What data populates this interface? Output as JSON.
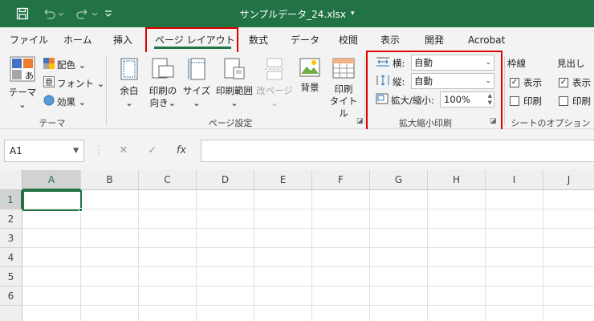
{
  "titlebar": {
    "save_icon": "save-icon",
    "undo_icon": "undo-icon",
    "redo_icon": "redo-icon",
    "customize_icon": "customize-qa-icon",
    "filename": "サンプルデータ_24.xlsx",
    "caret": "▾"
  },
  "tabs": [
    "ファイル",
    "ホーム",
    "挿入",
    "ページ レイアウト",
    "数式",
    "データ",
    "校閲",
    "表示",
    "開発",
    "Acrobat"
  ],
  "ribbon": {
    "theme": {
      "theme_label": "テーマ",
      "theme_caret": "⌄",
      "colors": "配色 ⌄",
      "fonts": "フォント ⌄",
      "effects": "効果 ⌄",
      "group": "テーマ"
    },
    "page_setup": {
      "margins": "余白",
      "orientation": "印刷の",
      "orientation2": "向き",
      "size": "サイズ",
      "print_area": "印刷範囲",
      "breaks": "改ページ",
      "background": "背景",
      "print_titles": "印刷",
      "print_titles2": "タイトル",
      "caret": "⌄",
      "group": "ページ設定"
    },
    "scale": {
      "width_label": "横:",
      "width_value": "自動",
      "height_label": "縦:",
      "height_value": "自動",
      "scale_label": "拡大/縮小:",
      "scale_value": "100%",
      "group": "拡大縮小印刷"
    },
    "sheet_options": {
      "gridlines": "枠線",
      "headings": "見出し",
      "view": "表示",
      "print": "印刷",
      "view2": "表示",
      "print2": "印刷",
      "group": "シートのオプション"
    }
  },
  "formula": {
    "namebox": "A1",
    "cancel": "✕",
    "enter": "✓",
    "fx": "fx",
    "value": ""
  },
  "grid": {
    "columns": [
      "A",
      "B",
      "C",
      "D",
      "E",
      "F",
      "G",
      "H",
      "I",
      "J"
    ],
    "rows": [
      "1",
      "2",
      "3",
      "4",
      "5",
      "6"
    ],
    "selected_cell": "A1"
  },
  "colors": {
    "accent": "#217346",
    "highlight": "#e00000"
  }
}
